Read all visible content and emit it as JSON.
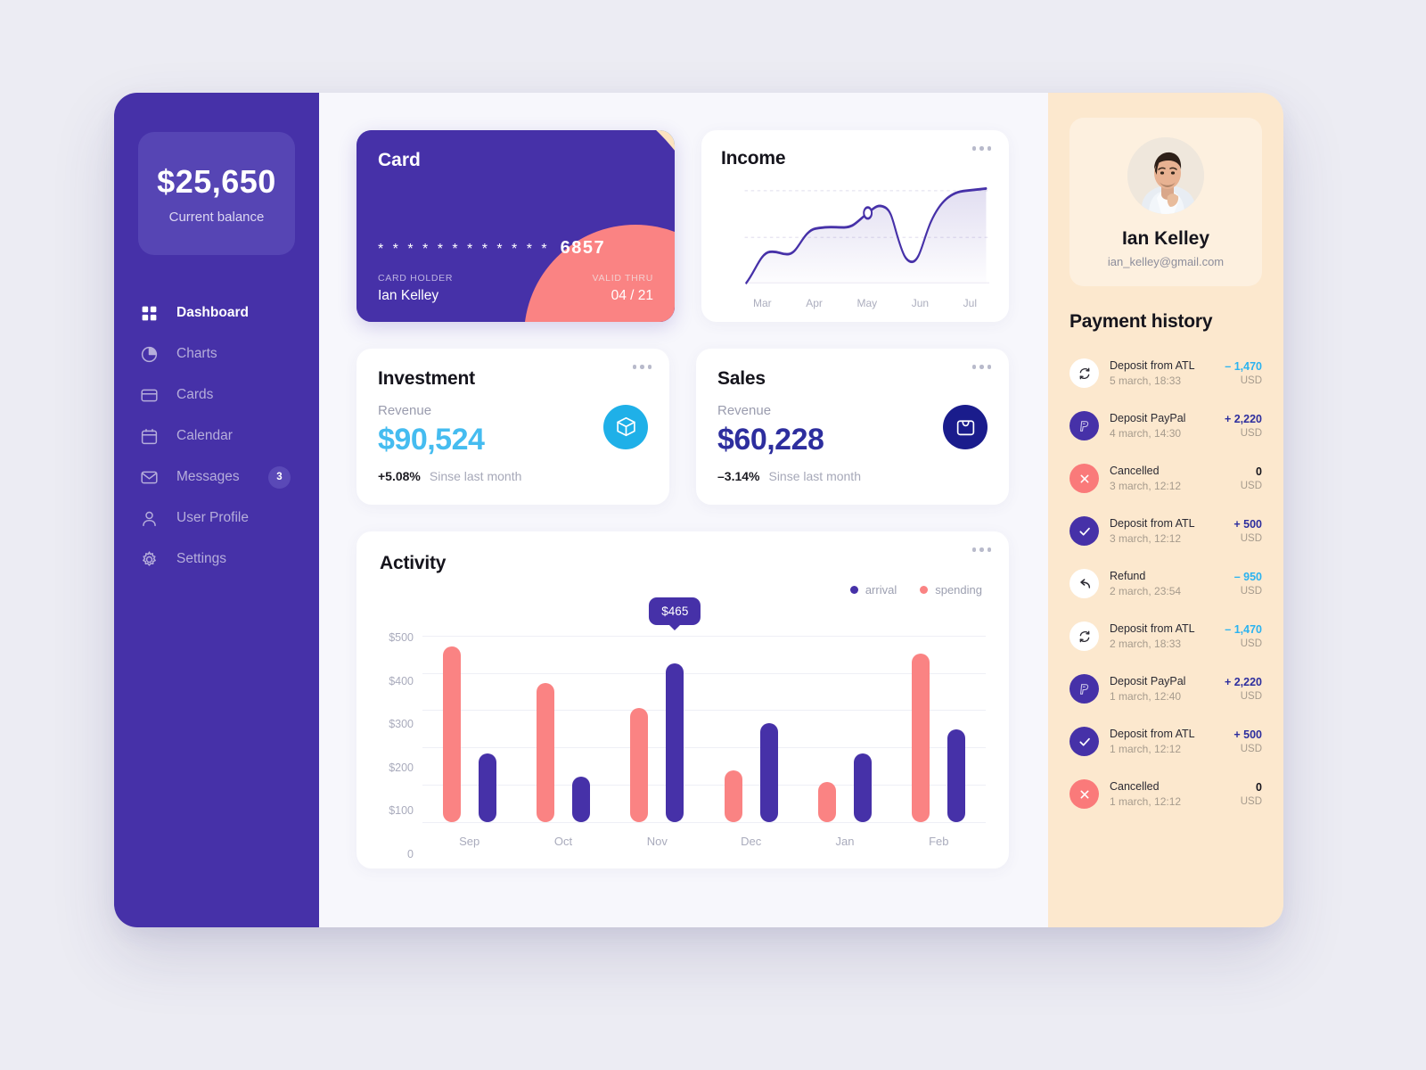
{
  "sidebar": {
    "balance": {
      "amount": "$25,650",
      "label": "Current balance"
    },
    "items": [
      {
        "label": "Dashboard",
        "icon": "grid-icon",
        "active": true
      },
      {
        "label": "Charts",
        "icon": "pie-chart-icon"
      },
      {
        "label": "Cards",
        "icon": "credit-card-icon"
      },
      {
        "label": "Calendar",
        "icon": "calendar-icon"
      },
      {
        "label": "Messages",
        "icon": "envelope-icon",
        "badge": "3"
      },
      {
        "label": "User Profile",
        "icon": "person-icon"
      },
      {
        "label": "Settings",
        "icon": "gear-icon"
      }
    ]
  },
  "credit_card": {
    "title": "Card",
    "stars": "* * * *   * * * *   * * * *",
    "last4": "6857",
    "holder_label": "CARD HOLDER",
    "holder_name": "Ian Kelley",
    "valid_label": "VALID THRU",
    "valid_value": "04 / 21"
  },
  "income": {
    "title": "Income",
    "menu": "more-options"
  },
  "investment": {
    "title": "Investment",
    "revenue_label": "Revenue",
    "amount": "$90,524",
    "amount_color": "#45BCF0",
    "percent": "+5.08%",
    "since": "Sinse last month",
    "badge_color": "#1FB0E8",
    "icon": "package-icon"
  },
  "sales": {
    "title": "Sales",
    "revenue_label": "Revenue",
    "amount": "$60,228",
    "amount_color": "#2D2E9E",
    "percent": "–3.14%",
    "since": "Sinse last month",
    "badge_color": "#1A1C8C",
    "icon": "shopping-bag-icon"
  },
  "activity": {
    "title": "Activity",
    "tooltip": "$465"
  },
  "profile": {
    "name": "Ian Kelley",
    "email": "ian_kelley@gmail.com"
  },
  "payment_history": {
    "title": "Payment history",
    "rows": [
      {
        "label": "Deposit from ATL",
        "date": "5 march, 18:33",
        "value": "– 1,470",
        "currency": "USD",
        "value_color": "#2BB3F0",
        "icon": "sync-icon",
        "icon_bg": "#FFFFFF",
        "icon_color": "#2B2A33"
      },
      {
        "label": "Deposit PayPal",
        "date": "4 march, 14:30",
        "value": "+ 2,220",
        "currency": "USD",
        "value_color": "#2D2E9E",
        "icon": "paypal-icon",
        "icon_bg": "#4631A8",
        "icon_color": "#C9C2E8"
      },
      {
        "label": "Cancelled",
        "date": "3 march, 12:12",
        "value": "0",
        "currency": "USD",
        "value_color": "#15141C",
        "icon": "close-icon",
        "icon_bg": "#FA7A7A",
        "icon_color": "#FFFFFF"
      },
      {
        "label": "Deposit from ATL",
        "date": "3 march, 12:12",
        "value": "+ 500",
        "currency": "USD",
        "value_color": "#2D2E9E",
        "icon": "check-icon",
        "icon_bg": "#4631A8",
        "icon_color": "#FFFFFF"
      },
      {
        "label": "Refund",
        "date": "2 march, 23:54",
        "value": "– 950",
        "currency": "USD",
        "value_color": "#2BB3F0",
        "icon": "back-arrow-icon",
        "icon_bg": "#FFFFFF",
        "icon_color": "#2B2A33"
      },
      {
        "label": "Deposit from ATL",
        "date": "2 march, 18:33",
        "value": "– 1,470",
        "currency": "USD",
        "value_color": "#2BB3F0",
        "icon": "sync-icon",
        "icon_bg": "#FFFFFF",
        "icon_color": "#2B2A33"
      },
      {
        "label": "Deposit PayPal",
        "date": "1 march, 12:40",
        "value": "+ 2,220",
        "currency": "USD",
        "value_color": "#2D2E9E",
        "icon": "paypal-icon",
        "icon_bg": "#4631A8",
        "icon_color": "#C9C2E8"
      },
      {
        "label": "Deposit from ATL",
        "date": "1 march, 12:12",
        "value": "+ 500",
        "currency": "USD",
        "value_color": "#2D2E9E",
        "icon": "check-icon",
        "icon_bg": "#4631A8",
        "icon_color": "#FFFFFF"
      },
      {
        "label": "Cancelled",
        "date": "1 march, 12:12",
        "value": "0",
        "currency": "USD",
        "value_color": "#15141C",
        "icon": "close-icon",
        "icon_bg": "#FA7A7A",
        "icon_color": "#FFFFFF"
      }
    ]
  },
  "chart_data": [
    {
      "type": "bar",
      "title": "Activity",
      "categories": [
        "Sep",
        "Oct",
        "Nov",
        "Dec",
        "Jan",
        "Feb"
      ],
      "series": [
        {
          "name": "spending",
          "color": "#FA8383",
          "values": [
            470,
            372,
            305,
            138,
            107,
            452
          ]
        },
        {
          "name": "arrival",
          "color": "#4631A8",
          "values": [
            185,
            122,
            425,
            265,
            185,
            248
          ]
        }
      ],
      "ytick_labels": [
        "$500",
        "$400",
        "$300",
        "$200",
        "$100",
        "0"
      ],
      "ytick_values": [
        500,
        400,
        300,
        200,
        100,
        0
      ],
      "ylim": [
        0,
        540
      ],
      "xlabel": "",
      "ylabel": "",
      "grid": true,
      "legend_position": "top-right",
      "annotations": [
        {
          "text": "$465",
          "category": "Nov",
          "series": "arrival"
        }
      ]
    },
    {
      "type": "line",
      "title": "Income",
      "x": [
        "Mar",
        "Apr",
        "May",
        "Jun",
        "Jul"
      ],
      "categories": [
        "Mar",
        "Apr",
        "May",
        "Jun",
        "Jul"
      ],
      "values": [
        8,
        40,
        55,
        72,
        97
      ],
      "series": [
        {
          "name": "income",
          "color": "#4631A8",
          "values": [
            8,
            40,
            55,
            72,
            97
          ]
        }
      ],
      "ylim": [
        0,
        110
      ],
      "grid": true,
      "xlabel": "",
      "ylabel": "",
      "marker_at": "May",
      "area_fill": true
    }
  ]
}
